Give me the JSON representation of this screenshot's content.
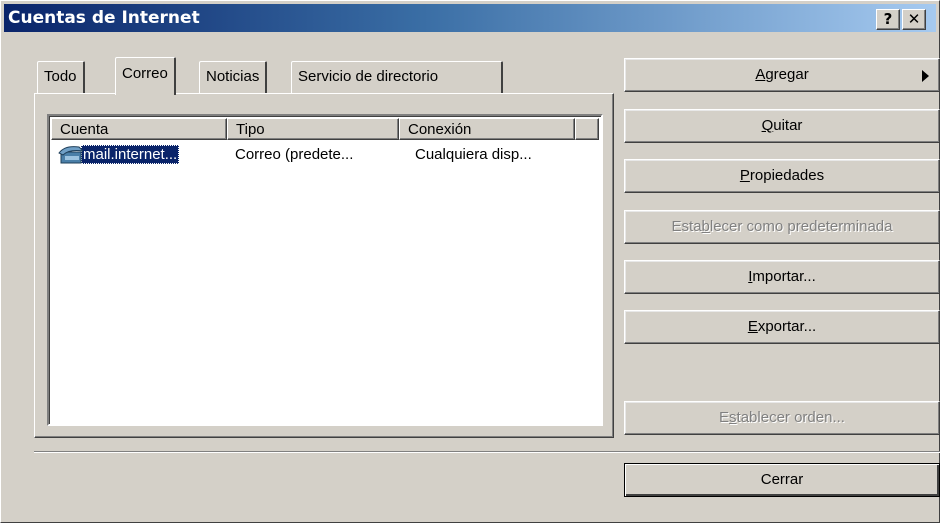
{
  "window": {
    "title": "Cuentas de Internet",
    "help_label": "?",
    "close_label": "✕"
  },
  "tabs": [
    {
      "label": "Todo"
    },
    {
      "label": "Correo",
      "active": true
    },
    {
      "label": "Noticias"
    },
    {
      "label": "Servicio de directorio"
    }
  ],
  "list": {
    "columns": [
      "Cuenta",
      "Tipo",
      "Conexión"
    ],
    "rows": [
      {
        "icon": "mail-account-icon",
        "cuenta": "mail.internet...",
        "tipo": "Correo (predete...",
        "conexion": "Cualquiera disp..."
      }
    ]
  },
  "buttons": {
    "agregar": {
      "pre": "",
      "mnemonic": "A",
      "post": "gregar"
    },
    "quitar": {
      "pre": "",
      "mnemonic": "Q",
      "post": "uitar"
    },
    "propiedades": {
      "pre": "",
      "mnemonic": "P",
      "post": "ropiedades"
    },
    "establecer_pred": {
      "pre": "Esta",
      "mnemonic": "b",
      "post": "lecer como predeterminada"
    },
    "importar": {
      "pre": "",
      "mnemonic": "I",
      "post": "mportar..."
    },
    "exportar": {
      "pre": "",
      "mnemonic": "E",
      "post": "xportar..."
    },
    "establecer_orden": {
      "pre": "E",
      "mnemonic": "s",
      "post": "tablecer orden..."
    },
    "cerrar": {
      "label": "Cerrar"
    }
  },
  "colors": {
    "title_start": "#0a246a",
    "title_end": "#a6caf0",
    "face": "#d4d0c8",
    "selection": "#0a246a"
  }
}
